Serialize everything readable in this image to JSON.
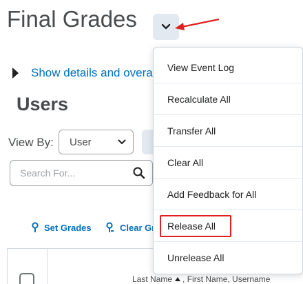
{
  "page": {
    "title": "Final Grades",
    "show_details_link": "Show details and overa",
    "section_heading": "Users"
  },
  "filters": {
    "view_by_label": "View By:",
    "view_by_value": "User",
    "search_placeholder": "Search For..."
  },
  "actions": {
    "set_grades": "Set Grades",
    "clear_grades": "Clear Gr"
  },
  "grid": {
    "column_header": "Last Name",
    "column_header_rest": ", First Name, Username"
  },
  "context_menu": {
    "items": [
      {
        "label": "View Event Log"
      },
      {
        "label": "Recalculate All"
      },
      {
        "label": "Transfer All"
      },
      {
        "label": "Clear All"
      },
      {
        "label": "Add Feedback for All"
      },
      {
        "label": "Release All",
        "highlighted": true
      },
      {
        "label": "Unrelease All"
      }
    ]
  },
  "colors": {
    "link": "#006fbf",
    "annotation": "#e02020",
    "button_bg": "#e3e9f1"
  }
}
